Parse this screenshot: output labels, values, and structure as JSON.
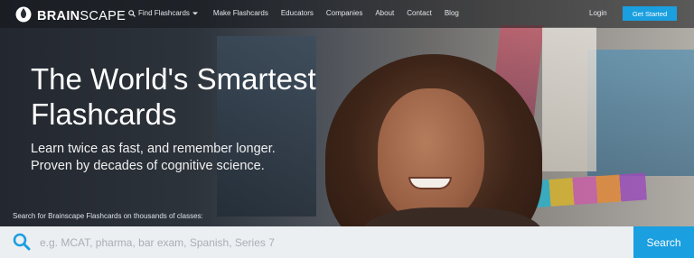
{
  "brand": {
    "name_bold": "BRAIN",
    "name_light": "SCAPE",
    "logo_icon": "brain-flame-icon"
  },
  "nav": {
    "items": [
      {
        "label": "Find Flashcards",
        "icon": "search-icon",
        "dropdown": true
      },
      {
        "label": "Make Flashcards"
      },
      {
        "label": "Educators"
      },
      {
        "label": "Companies"
      },
      {
        "label": "About"
      },
      {
        "label": "Contact"
      },
      {
        "label": "Blog"
      }
    ],
    "login": "Login",
    "cta": "Get Started"
  },
  "hero": {
    "headline_line1": "The World's Smartest",
    "headline_line2": "Flashcards",
    "sub_line1": "Learn twice as fast, and remember longer.",
    "sub_line2": "Proven by decades of cognitive science."
  },
  "search": {
    "label": "Search for Brainscape Flashcards on thousands of classes:",
    "placeholder": "e.g. MCAT, pharma, bar exam, Spanish, Series 7",
    "button": "Search"
  },
  "colors": {
    "accent": "#1a9fe0",
    "search_bg": "#eceff1"
  }
}
